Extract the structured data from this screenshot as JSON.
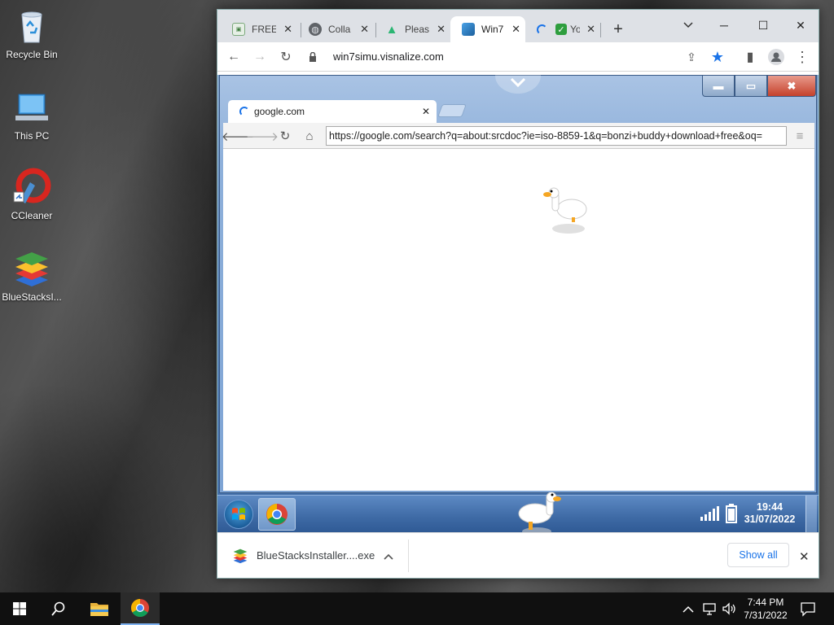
{
  "desktop": {
    "icons": [
      {
        "label": "Recycle Bin",
        "icon": "recycle-bin-icon"
      },
      {
        "label": "This PC",
        "icon": "this-pc-icon"
      },
      {
        "label": "CCleaner",
        "icon": "ccleaner-icon"
      },
      {
        "label": "BlueStacksI...",
        "icon": "bluestacks-icon"
      }
    ]
  },
  "browser": {
    "tabs": [
      {
        "title": "FREE",
        "icon": "free-site-favicon"
      },
      {
        "title": "Colla",
        "icon": "globe-icon"
      },
      {
        "title": "Pleas",
        "icon": "green-a-icon"
      },
      {
        "title": "Win7",
        "icon": "win7-icon",
        "active": true
      },
      {
        "title": "Yo",
        "icon": "checkbox-icon"
      }
    ],
    "url": "win7simu.visnalize.com",
    "colors": {
      "tabstrip": "#dee1e6",
      "accent": "#1a73e8"
    }
  },
  "inner_browser": {
    "tab_title": "google.com",
    "url": "https://google.com/search?q=about:srcdoc?ie=iso-8859-1&q=bonzi+buddy+download+free&oq="
  },
  "win7_taskbar": {
    "time": "19:44",
    "date": "31/07/2022"
  },
  "download_bar": {
    "file_name": "BlueStacksInstaller....exe",
    "show_all_label": "Show all"
  },
  "taskbar": {
    "time": "7:44 PM",
    "date": "7/31/2022"
  }
}
